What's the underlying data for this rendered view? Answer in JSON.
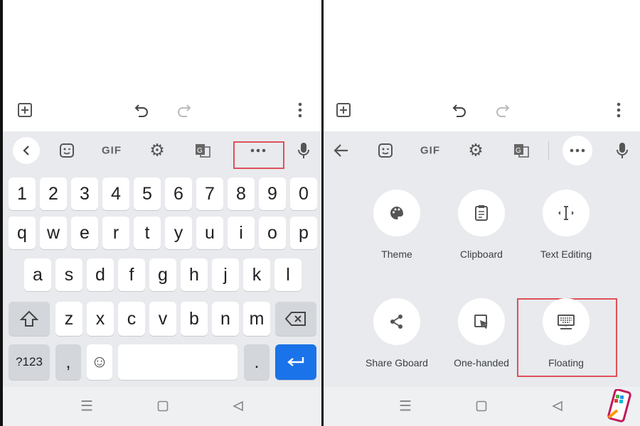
{
  "left": {
    "toolbar": {
      "icons": [
        "add-box-icon",
        "undo-icon",
        "redo-icon",
        "more-vert-icon"
      ]
    },
    "strip": {
      "gif_label": "GIF",
      "highlighted": "more-options"
    },
    "rows": [
      [
        "1",
        "2",
        "3",
        "4",
        "5",
        "6",
        "7",
        "8",
        "9",
        "0"
      ],
      [
        "q",
        "w",
        "e",
        "r",
        "t",
        "y",
        "u",
        "i",
        "o",
        "p"
      ],
      [
        "a",
        "s",
        "d",
        "f",
        "g",
        "h",
        "j",
        "k",
        "l"
      ],
      [
        "z",
        "x",
        "c",
        "v",
        "b",
        "n",
        "m"
      ]
    ],
    "bottom": {
      "symbols": "?123",
      "comma": ",",
      "period": "."
    }
  },
  "right": {
    "strip": {
      "gif_label": "GIF"
    },
    "menu": [
      {
        "label": "Theme",
        "icon": "palette-icon"
      },
      {
        "label": "Clipboard",
        "icon": "clipboard-icon"
      },
      {
        "label": "Text Editing",
        "icon": "text-cursor-icon"
      },
      {
        "label": "Share Gboard",
        "icon": "share-icon"
      },
      {
        "label": "One-handed",
        "icon": "one-handed-icon"
      },
      {
        "label": "Floating",
        "icon": "floating-keyboard-icon"
      }
    ],
    "highlighted": "Floating"
  },
  "colors": {
    "enter_key": "#1a73e8",
    "highlight_box": "#e0505a",
    "keyboard_bg": "#e8eaed"
  }
}
